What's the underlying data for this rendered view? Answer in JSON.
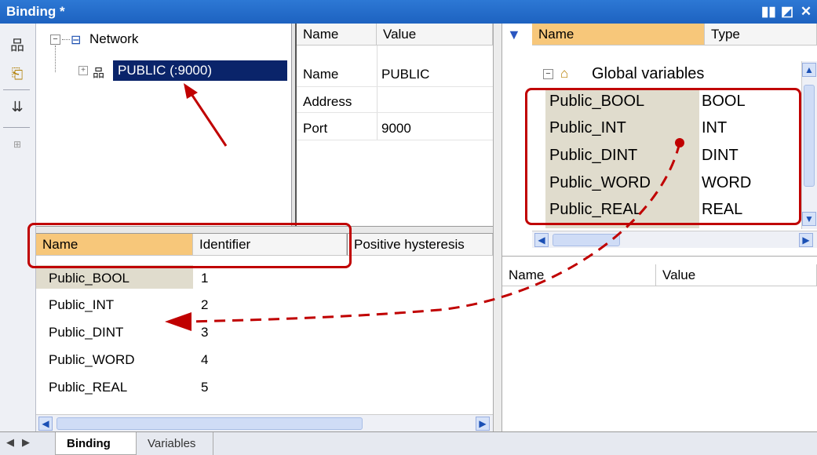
{
  "window": {
    "title": "Binding *",
    "controls": [
      "restore-icon",
      "edit-icon",
      "close-icon"
    ]
  },
  "toolbar": {
    "icons": [
      "network-add-icon",
      "binding-add-icon",
      "insert-variable-icon",
      "expand-icon"
    ]
  },
  "network_tree": {
    "root": "Network",
    "child": "PUBLIC (:9000)"
  },
  "properties": {
    "headers": {
      "name": "Name",
      "value": "Value"
    },
    "rows": [
      {
        "name": "Name",
        "value": "PUBLIC"
      },
      {
        "name": "Address",
        "value": ""
      },
      {
        "name": "Port",
        "value": "9000"
      }
    ]
  },
  "bindings": {
    "headers": {
      "name": "Name",
      "identifier": "Identifier",
      "hysteresis": "Positive hysteresis"
    },
    "rows": [
      {
        "name": "Public_BOOL",
        "id": "1"
      },
      {
        "name": "Public_INT",
        "id": "2"
      },
      {
        "name": "Public_DINT",
        "id": "3"
      },
      {
        "name": "Public_WORD",
        "id": "4"
      },
      {
        "name": "Public_REAL",
        "id": "5"
      }
    ]
  },
  "globals": {
    "headers": {
      "name": "Name",
      "type": "Type"
    },
    "group": "Global variables",
    "rows": [
      {
        "name": "Public_BOOL",
        "type": "BOOL"
      },
      {
        "name": "Public_INT",
        "type": "INT"
      },
      {
        "name": "Public_DINT",
        "type": "DINT"
      },
      {
        "name": "Public_WORD",
        "type": "WORD"
      },
      {
        "name": "Public_REAL",
        "type": "REAL"
      }
    ]
  },
  "watch": {
    "headers": {
      "name": "Name",
      "value": "Value"
    }
  },
  "tabs": {
    "binding": "Binding",
    "variables": "Variables"
  },
  "colors": {
    "title_bar": "#1d62c0",
    "selection": "#0a246a",
    "header_highlight": "#f7c77a",
    "annotation": "#c00000"
  }
}
